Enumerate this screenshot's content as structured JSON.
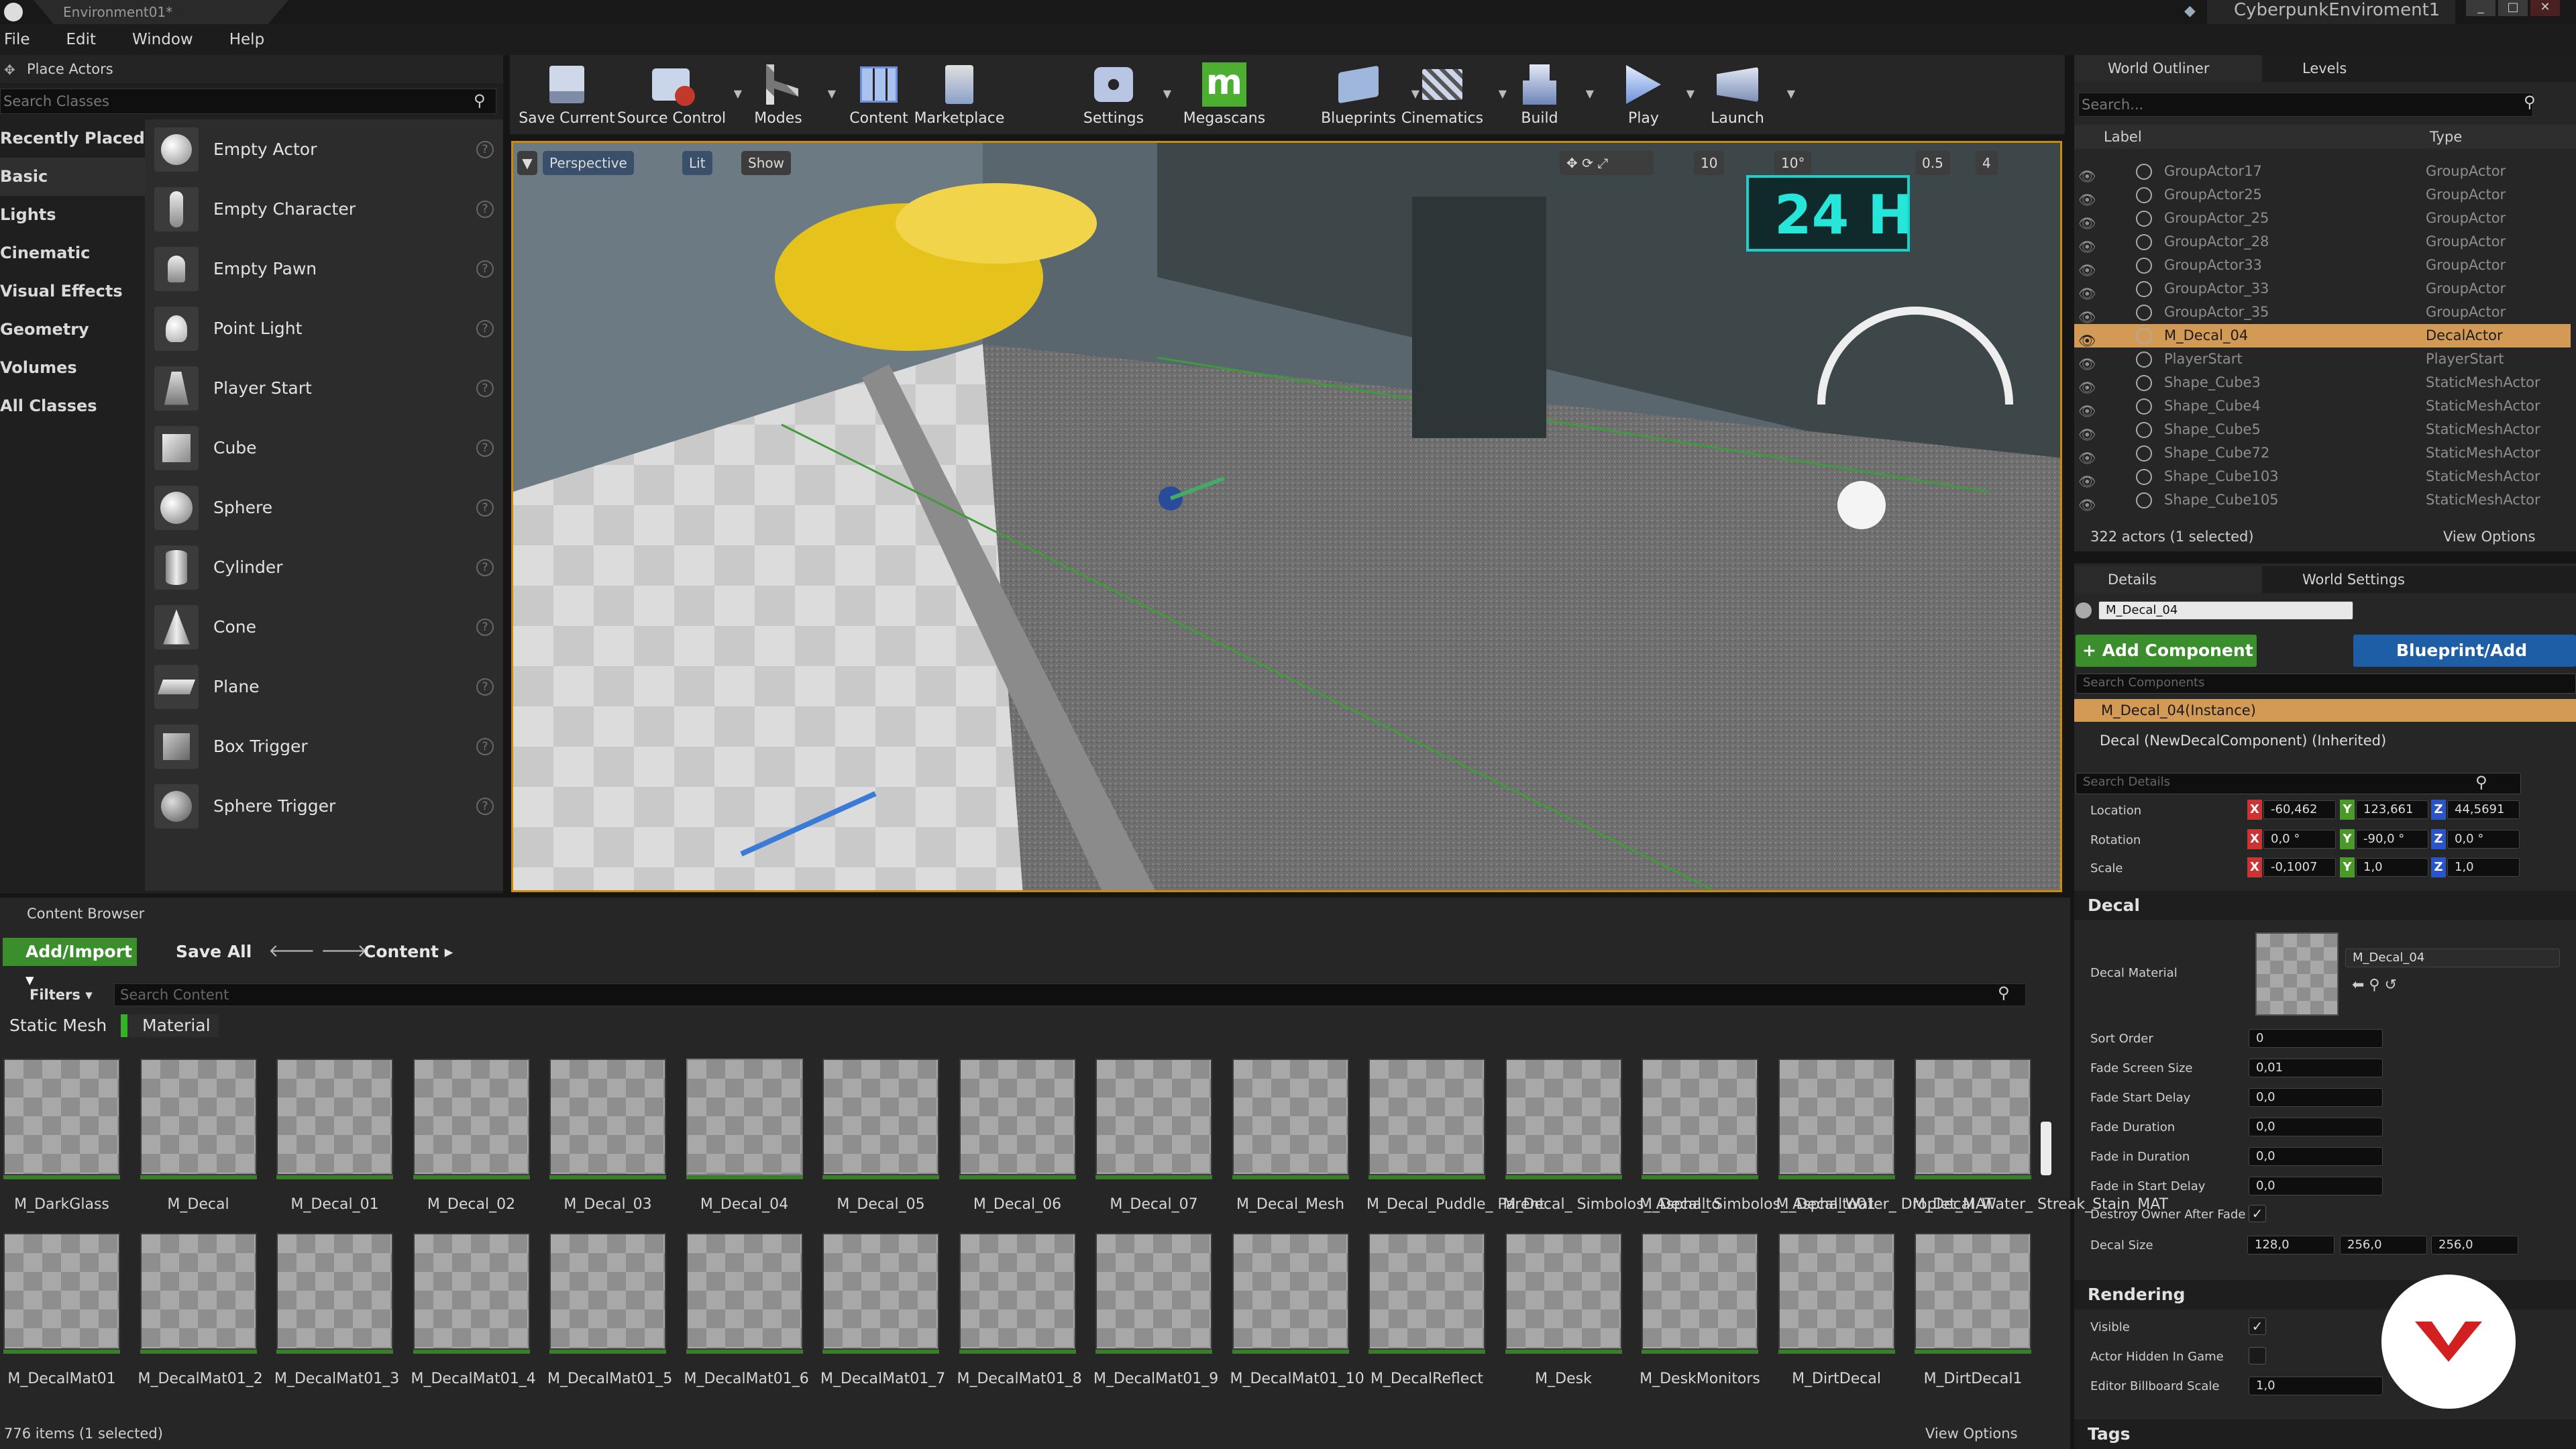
{
  "window": {
    "tab": "Environment01*",
    "project": "CyberpunkEnviroment1"
  },
  "menu": [
    "File",
    "Edit",
    "Window",
    "Help"
  ],
  "place_actors": {
    "title": "Place Actors",
    "search_placeholder": "Search Classes",
    "categories": [
      "Recently Placed",
      "Basic",
      "Lights",
      "Cinematic",
      "Visual Effects",
      "Geometry",
      "Volumes",
      "All Classes"
    ],
    "items": [
      "Empty Actor",
      "Empty Character",
      "Empty Pawn",
      "Point Light",
      "Player Start",
      "Cube",
      "Sphere",
      "Cylinder",
      "Cone",
      "Plane",
      "Box Trigger",
      "Sphere Trigger"
    ]
  },
  "toolbar": [
    "Save Current",
    "Source Control",
    "Modes",
    "Content",
    "Marketplace",
    "Settings",
    "Megascans",
    "Blueprints",
    "Cinematics",
    "Build",
    "Play",
    "Launch"
  ],
  "viewport": {
    "perspective": "Perspective",
    "lit": "Lit",
    "show": "Show",
    "grid": "10",
    "angle": "10°",
    "scale": "0.5",
    "cam": "4",
    "sign": "24 H"
  },
  "outliner": {
    "tab1": "World Outliner",
    "tab2": "Levels",
    "search_placeholder": "Search...",
    "col_label": "Label",
    "col_type": "Type",
    "rows": [
      {
        "label": "GroupActor17",
        "type": "GroupActor"
      },
      {
        "label": "GroupActor25",
        "type": "GroupActor"
      },
      {
        "label": "GroupActor_25",
        "type": "GroupActor"
      },
      {
        "label": "GroupActor_28",
        "type": "GroupActor"
      },
      {
        "label": "GroupActor33",
        "type": "GroupActor"
      },
      {
        "label": "GroupActor_33",
        "type": "GroupActor"
      },
      {
        "label": "GroupActor_35",
        "type": "GroupActor"
      },
      {
        "label": "M_Decal_04",
        "type": "DecalActor"
      },
      {
        "label": "PlayerStart",
        "type": "PlayerStart"
      },
      {
        "label": "Shape_Cube3",
        "type": "StaticMeshActor"
      },
      {
        "label": "Shape_Cube4",
        "type": "StaticMeshActor"
      },
      {
        "label": "Shape_Cube5",
        "type": "StaticMeshActor"
      },
      {
        "label": "Shape_Cube72",
        "type": "StaticMeshActor"
      },
      {
        "label": "Shape_Cube103",
        "type": "StaticMeshActor"
      },
      {
        "label": "Shape_Cube105",
        "type": "StaticMeshActor"
      }
    ],
    "status": "322 actors (1 selected)",
    "view_options": "View Options"
  },
  "details": {
    "tab1": "Details",
    "tab2": "World Settings",
    "name": "M_Decal_04",
    "add_component": "+ Add Component",
    "blueprint": "Blueprint/Add Script",
    "search_components": "Search Components",
    "instance": "M_Decal_04(Instance)",
    "decal_comp": "Decal (NewDecalComponent) (Inherited)",
    "search_details": "Search Details",
    "location_label": "Location",
    "rotation_label": "Rotation",
    "scale_label": "Scale",
    "location": [
      "-60,462",
      "123,661",
      "44,5691"
    ],
    "rotation": [
      "0,0 °",
      "-90,0 °",
      "0,0 °"
    ],
    "scale": [
      "-0,1007",
      "1,0",
      "1,0"
    ],
    "decal_section": "Decal",
    "decal_material_label": "Decal Material",
    "decal_material": "M_Decal_04",
    "props": [
      {
        "label": "Sort Order",
        "value": "0"
      },
      {
        "label": "Fade Screen Size",
        "value": "0,01"
      },
      {
        "label": "Fade Start Delay",
        "value": "0,0"
      },
      {
        "label": "Fade Duration",
        "value": "0,0"
      },
      {
        "label": "Fade in Duration",
        "value": "0,0"
      },
      {
        "label": "Fade in Start Delay",
        "value": "0,0"
      }
    ],
    "destroy_label": "Destroy Owner After Fade",
    "decal_size_label": "Decal Size",
    "decal_size": [
      "128,0",
      "256,0",
      "256,0"
    ],
    "rendering_section": "Rendering",
    "visible_label": "Visible",
    "hidden_label": "Actor Hidden In Game",
    "billboard_label": "Editor Billboard Scale",
    "billboard": "1,0",
    "tags_section": "Tags"
  },
  "content_browser": {
    "tab": "Content Browser",
    "add_import": "Add/Import",
    "save_all": "Save All",
    "path": "Content",
    "filters": "Filters",
    "search_placeholder": "Search Content",
    "filter1": "Static Mesh",
    "filter2": "Material",
    "row1": [
      "M_DarkGlass",
      "M_Decal",
      "M_Decal_01",
      "M_Decal_02",
      "M_Decal_03",
      "M_Decal_04",
      "M_Decal_05",
      "M_Decal_06",
      "M_Decal_07",
      "M_Decal_Mesh",
      "M_Decal_Puddle_ Parent",
      "M_Decal_ Simbolos_ Asphalto",
      "M_Decal_ Simbolos_ Asphalto01",
      "M_Decal_Water_ Droplet_MAT",
      "M_Decal_Water_ Streak_Stain_MAT"
    ],
    "row2": [
      "M_DecalMat01",
      "M_DecalMat01_2",
      "M_DecalMat01_3",
      "M_DecalMat01_4",
      "M_DecalMat01_5",
      "M_DecalMat01_6",
      "M_DecalMat01_7",
      "M_DecalMat01_8",
      "M_DecalMat01_9",
      "M_DecalMat01_10",
      "M_DecalReflect",
      "M_Desk",
      "M_DeskMonitors",
      "M_DirtDecal",
      "M_DirtDecal1"
    ],
    "status": "776 items (1 selected)",
    "view_options": "View Options"
  }
}
